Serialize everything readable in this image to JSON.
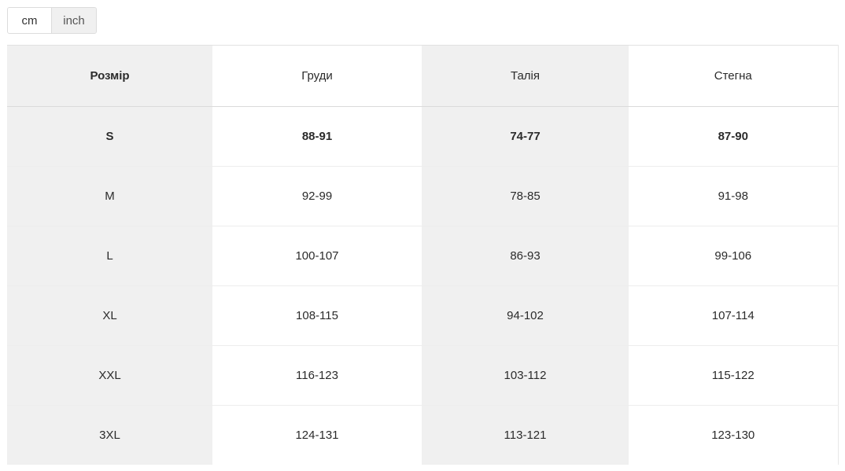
{
  "units": {
    "options": [
      {
        "label": "cm",
        "active": true
      },
      {
        "label": "inch",
        "active": false
      }
    ],
    "selected": "cm"
  },
  "table": {
    "headers": [
      "Розмір",
      "Груди",
      "Талія",
      "Стегна"
    ],
    "rows": [
      {
        "size": "S",
        "chest": "88-91",
        "waist": "74-77",
        "hips": "87-90",
        "bold": true
      },
      {
        "size": "M",
        "chest": "92-99",
        "waist": "78-85",
        "hips": "91-98",
        "bold": false
      },
      {
        "size": "L",
        "chest": "100-107",
        "waist": "86-93",
        "hips": "99-106",
        "bold": false
      },
      {
        "size": "XL",
        "chest": "108-115",
        "waist": "94-102",
        "hips": "107-114",
        "bold": false
      },
      {
        "size": "XXL",
        "chest": "116-123",
        "waist": "103-112",
        "hips": "115-122",
        "bold": false
      },
      {
        "size": "3XL",
        "chest": "124-131",
        "waist": "113-121",
        "hips": "123-130",
        "bold": false
      }
    ]
  },
  "colors": {
    "shaded_cell": "#f0f0f0",
    "plain_cell": "#ffffff",
    "border": "#ededed",
    "text": "#2b2b2b"
  }
}
